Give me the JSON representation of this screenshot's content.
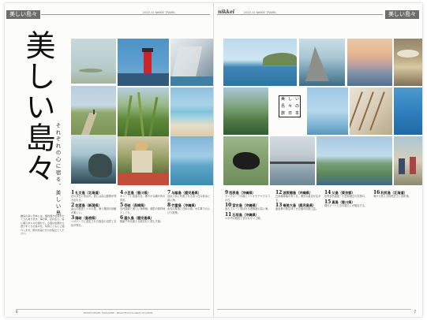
{
  "header": {
    "section_tab_left": "美しい島々",
    "section_tab_right": "美しい島々",
    "brand": "nikkei",
    "meta_left": "2015.12 NIKKEI TRAVEL",
    "meta_right": "2015.12 NIKKEI TRAVEL"
  },
  "feature": {
    "title": "美しい島々",
    "subtitle": "それぞれの心に宿る、美しい島",
    "intro": "離島の多い日本には、個性豊かな島がたくさんあります。海の青、空の広さ、島に暮らす人々の温かさ。今回は全国から選りすぐりの島々を、写真とともにご紹介します。旅の計画にぜひお役立てください。"
  },
  "icon_glyphs": [
    "美",
    "し",
    "い",
    "島",
    "々",
    "の",
    "旅",
    "日",
    "本"
  ],
  "entries_left": [
    {
      "num": "1",
      "title": "礼文島（北海道）",
      "body": "花の浮島と呼ばれ、夏には高山植物が咲き乱れる。"
    },
    {
      "num": "2",
      "title": "佐渡島（新潟県）",
      "body": "金山の歴史とトキの里。海と棚田の景観が美しい。"
    },
    {
      "num": "3",
      "title": "隠岐（島根県）",
      "body": "ジオパークに認定された独自の自然と文化が残る。"
    },
    {
      "num": "4",
      "title": "小豆島（香川県）",
      "body": "オリーブと醤油の島。穏やかな瀬戸内の風景。"
    },
    {
      "num": "5",
      "title": "壱岐（長崎県）",
      "body": "古代遺跡と美しい海岸線。焼酎の発祥地としても。"
    },
    {
      "num": "6",
      "title": "屋久島（鹿児島県）",
      "body": "樹齢千年を超える縄文杉と苔むす森。"
    },
    {
      "num": "7",
      "title": "与論島（鹿児島県）",
      "body": "百合ヶ浜に代表される真っ白な砂浜と碧い海。"
    },
    {
      "num": "8",
      "title": "竹富島（沖縄県）",
      "body": "赤瓦の集落と白砂の道。水牛車でのんびり散策。"
    }
  ],
  "entries_right": [
    {
      "num": "9",
      "title": "西表島（沖縄県）",
      "body": "マングローブの森とイリオモテヤマネコの島。"
    },
    {
      "num": "10",
      "title": "宮古島（沖縄県）",
      "body": "宮古ブルーと呼ばれる透明度の高い海。"
    },
    {
      "num": "11",
      "title": "石垣島（沖縄県）",
      "body": "川平湾の絶景と豊かなサンゴ礁。"
    },
    {
      "num": "12",
      "title": "波照間島（沖縄県）",
      "body": "日本最南端の有人島。満天の星空が広がる。"
    },
    {
      "num": "13",
      "title": "奄美大島（鹿児島県）",
      "body": "亜熱帯の原生林と大島紬の伝統工芸。"
    },
    {
      "num": "14",
      "title": "父島（東京都）",
      "body": "世界自然遺産・小笠原諸島の玄関口。"
    },
    {
      "num": "15",
      "title": "直島（香川県）",
      "body": "現代アートと島の暮らしが融合する。"
    },
    {
      "num": "16",
      "title": "利尻島（北海道）",
      "body": "海から聳える利尻富士と昆布漁。"
    }
  ],
  "folios": {
    "left": "6",
    "right": "7"
  },
  "footer_tiny": "NIKKEI TRAVEL MAGAZINE · BEAUTIFUL ISLANDS OF JAPAN"
}
